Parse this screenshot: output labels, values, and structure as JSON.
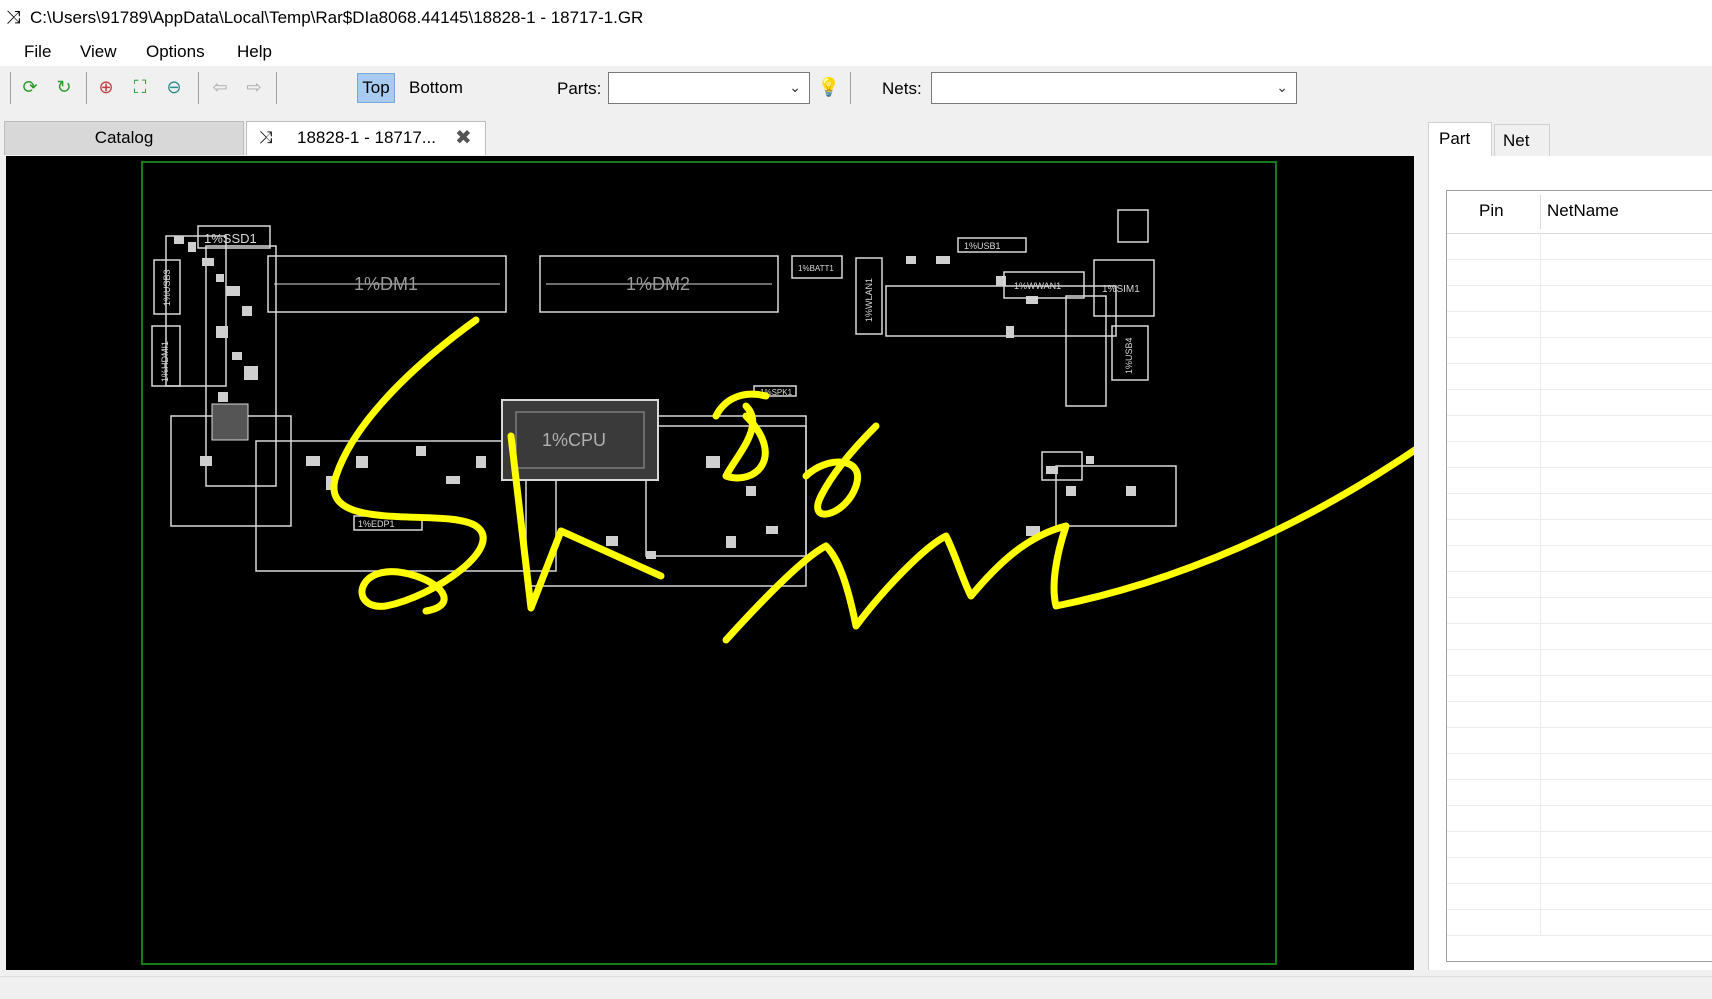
{
  "window": {
    "title": "C:\\Users\\91789\\AppData\\Local\\Temp\\Rar$DIa8068.44145\\18828-1 - 18717-1.GR",
    "icon": "shuffle-icon"
  },
  "menu": [
    "File",
    "View",
    "Options",
    "Help"
  ],
  "toolbar": {
    "icons": [
      "refresh-icon",
      "reload-icon",
      "zoom-in-icon",
      "fit-icon",
      "zoom-out-icon",
      "back-arrow-icon",
      "forward-arrow-icon"
    ],
    "side_top": "Top",
    "side_bottom": "Bottom",
    "parts_label": "Parts:",
    "parts_value": "",
    "bulb_icon": "lightbulb-icon",
    "nets_label": "Nets:",
    "nets_value": ""
  },
  "tabs": {
    "catalog": "Catalog",
    "file": "18828-1 - 18717...",
    "close_icon": "close-icon"
  },
  "board": {
    "labels": {
      "ssd": "1%SSD1",
      "dm1": "1%DM1",
      "dm2": "1%DM2",
      "cpu": "1%CPU",
      "usb3": "1%USB3",
      "hdmi": "1%HDMI1",
      "batt": "1%BATT1",
      "wlan": "1%WLAN1",
      "usb1": "1%USB1",
      "wwan": "1%WWAN1",
      "sim": "1%SIM1",
      "usb4": "1%USB4",
      "spk": "1%SPK1",
      "edp": "1%EDP1"
    },
    "board_outline_color": "#1a7a1a",
    "component_color": "#d8d8d8",
    "signature_color": "#ffff00"
  },
  "right_panel": {
    "tab_part": "Part",
    "tab_net": "Net",
    "columns": [
      "Pin",
      "NetName"
    ],
    "rows": []
  }
}
